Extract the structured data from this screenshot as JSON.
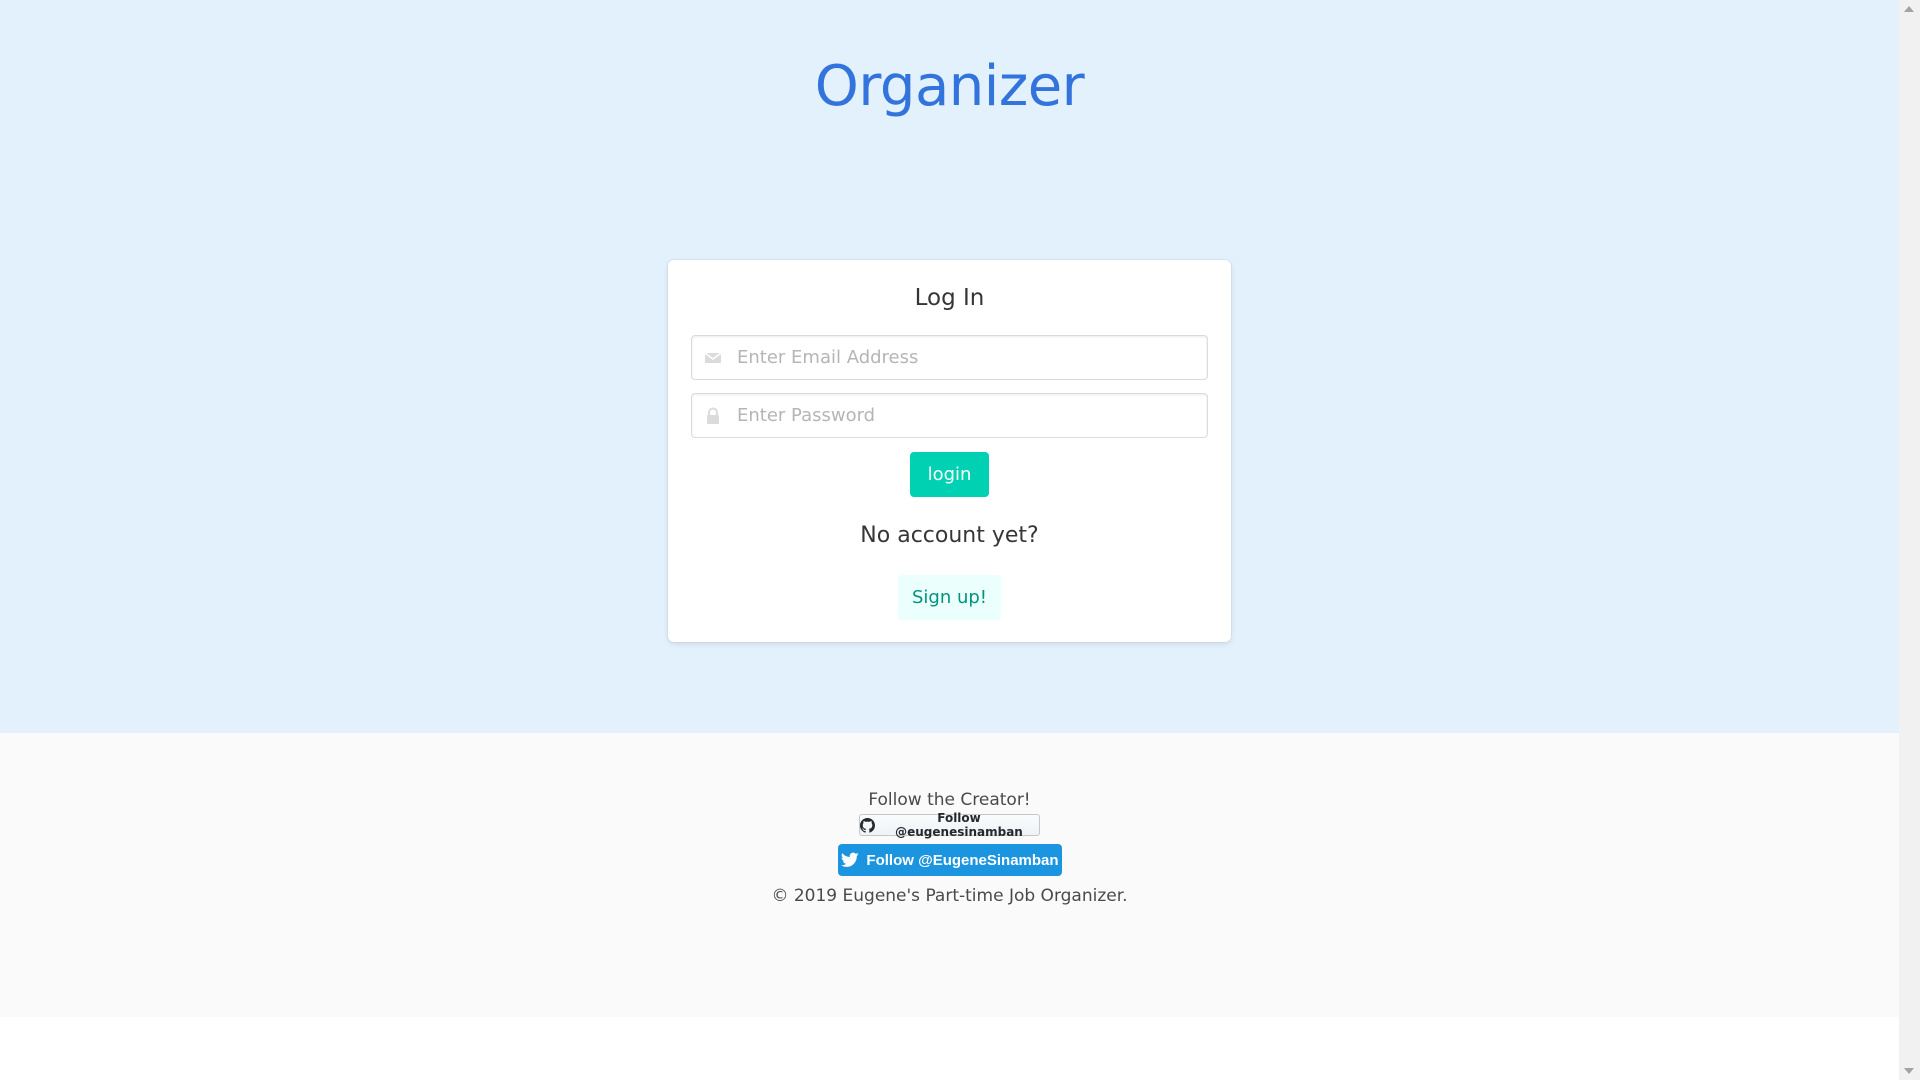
{
  "header": {
    "title": "Organizer"
  },
  "login_card": {
    "title": "Log In",
    "email_placeholder": "Enter Email Address",
    "email_value": "",
    "password_placeholder": "Enter Password",
    "password_value": "",
    "email_icon": "envelope-icon",
    "password_icon": "lock-icon",
    "login_label": "login",
    "no_account_text": "No account yet?",
    "signup_label": "Sign up!"
  },
  "footer": {
    "follow_text": "Follow the Creator!",
    "github_button_label": "Follow @eugenesinamban",
    "github_icon": "github-icon",
    "twitter_button_label": "Follow @EugeneSinamban",
    "twitter_icon": "twitter-bird-icon",
    "copyright": "© 2019 Eugene's Part-time Job Organizer."
  },
  "colors": {
    "hero_background": "#e3f1fd",
    "title": "#3273dc",
    "primary_button": "#00d1b2",
    "signup_button_bg": "#ebfffc",
    "signup_button_text": "#00947e",
    "twitter_blue": "#1b95e0",
    "footer_background": "#fafafa"
  }
}
